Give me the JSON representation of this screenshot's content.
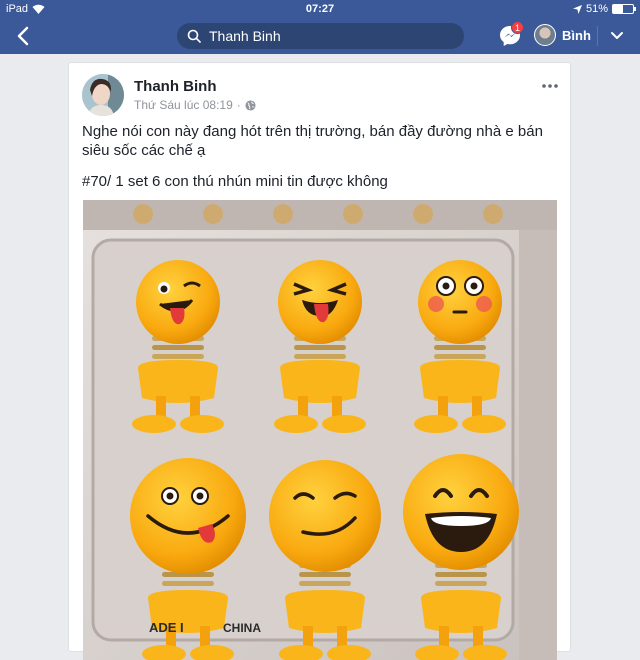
{
  "status_bar": {
    "device": "iPad",
    "time": "07:27",
    "battery": "51%",
    "battery_level": 0.51
  },
  "nav": {
    "search_value": "Thanh Binh",
    "messenger_badge": "1",
    "profile_name": "Bình"
  },
  "post": {
    "author": "Thanh Binh",
    "timestamp": "Thứ Sáu lúc 08:19",
    "text_line1": "Nghe nói con này đang hót trên thị trường, bán đầy đường nhà e bán siêu sốc các chế ạ",
    "text_line2": "#70/ 1 set 6 con thú nhún mini tin được không"
  },
  "photo": {
    "caption_left": "ADE I",
    "caption_mid": "CHINA"
  },
  "colors": {
    "brand": "#3b5998",
    "badge": "#fa3e3e",
    "toy_yellow": "#f9b51a"
  }
}
